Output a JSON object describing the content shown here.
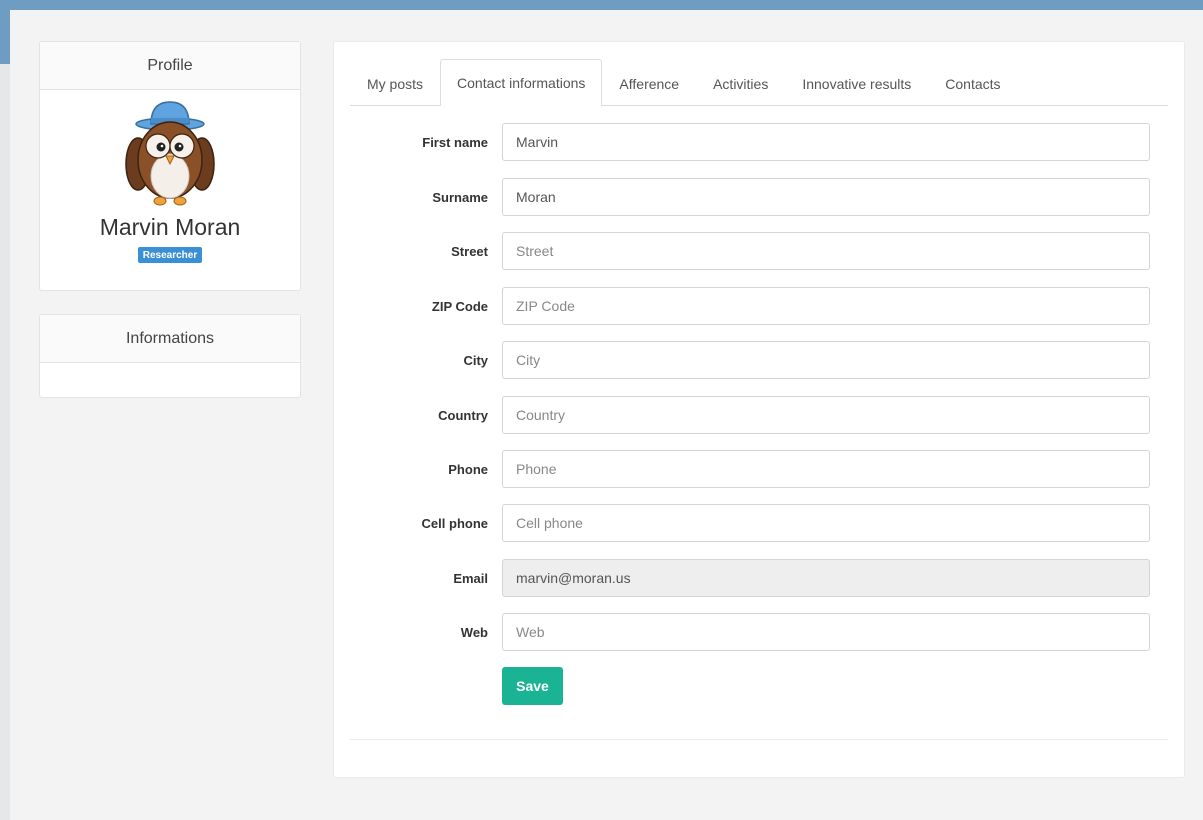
{
  "profile": {
    "heading": "Profile",
    "name": "Marvin Moran",
    "role": "Researcher"
  },
  "informations": {
    "heading": "Informations"
  },
  "tabs": [
    {
      "label": "My posts",
      "active": false
    },
    {
      "label": "Contact informations",
      "active": true
    },
    {
      "label": "Afference",
      "active": false
    },
    {
      "label": "Activities",
      "active": false
    },
    {
      "label": "Innovative results",
      "active": false
    },
    {
      "label": "Contacts",
      "active": false
    }
  ],
  "form": {
    "fields": [
      {
        "label": "First name",
        "value": "Marvin",
        "placeholder": "First name"
      },
      {
        "label": "Surname",
        "value": "Moran",
        "placeholder": "Surname"
      },
      {
        "label": "Street",
        "value": "",
        "placeholder": "Street"
      },
      {
        "label": "ZIP Code",
        "value": "",
        "placeholder": "ZIP Code"
      },
      {
        "label": "City",
        "value": "",
        "placeholder": "City"
      },
      {
        "label": "Country",
        "value": "",
        "placeholder": "Country"
      },
      {
        "label": "Phone",
        "value": "",
        "placeholder": "Phone"
      },
      {
        "label": "Cell phone",
        "value": "",
        "placeholder": "Cell phone"
      },
      {
        "label": "Email",
        "value": "marvin@moran.us",
        "placeholder": "",
        "readonly": true
      },
      {
        "label": "Web",
        "value": "",
        "placeholder": "Web"
      }
    ],
    "save_label": "Save"
  },
  "colors": {
    "top_bar": "#6f9dc2",
    "badge": "#3b8fd3",
    "save_button": "#1ab394",
    "hat": "#5fa3e0"
  },
  "icons": {
    "avatar": "owl-with-bowler-hat"
  }
}
